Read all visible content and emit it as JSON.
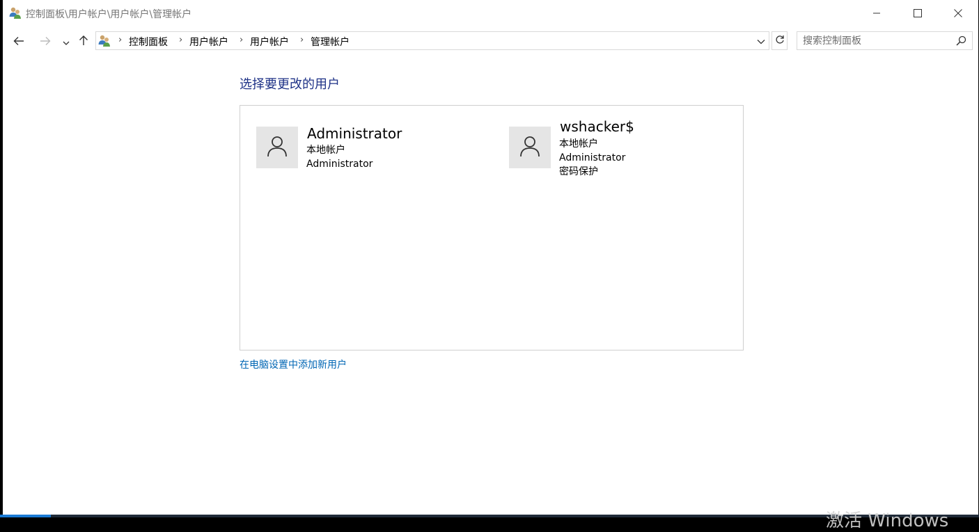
{
  "window": {
    "title": "控制面板\\用户帐户\\用户帐户\\管理帐户",
    "icons": [
      "user-accounts-icon",
      "minimize-icon",
      "maximize-icon",
      "close-icon"
    ]
  },
  "nav": {
    "icons": [
      "back-arrow-icon",
      "forward-arrow-icon",
      "recent-locations-chevron-icon",
      "up-arrow-icon",
      "refresh-icon"
    ]
  },
  "address": {
    "crumbs": [
      "控制面板",
      "用户帐户",
      "用户帐户",
      "管理帐户"
    ]
  },
  "search": {
    "placeholder": "搜索控制面板"
  },
  "content": {
    "heading": "选择要更改的用户",
    "users": [
      {
        "name": "Administrator",
        "details": [
          "本地帐户",
          "Administrator"
        ]
      },
      {
        "name": "wshacker$",
        "details": [
          "本地帐户",
          "Administrator",
          "密码保护"
        ]
      }
    ],
    "add_user_link": "在电脑设置中添加新用户"
  },
  "watermark": "激活 Windows",
  "colors": {
    "heading": "#1e3287",
    "link": "#0066b4",
    "avatar_bg": "#e5e5e5"
  }
}
